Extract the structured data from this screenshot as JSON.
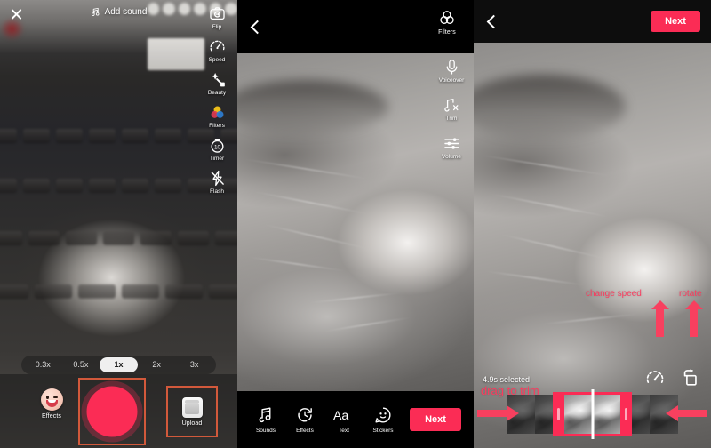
{
  "capture": {
    "close_icon": "close-x-icon",
    "add_sound_label": "Add sound",
    "music_icon": "music-note-icon",
    "tools": [
      {
        "label": "Flip",
        "icon": "camera-flip-icon"
      },
      {
        "label": "Speed",
        "icon": "speedometer-icon"
      },
      {
        "label": "Beauty",
        "icon": "beauty-wand-icon"
      },
      {
        "label": "Filters",
        "icon": "filters-circles-icon"
      },
      {
        "label": "Timer",
        "icon": "timer-10-icon"
      },
      {
        "label": "Flash",
        "icon": "flash-off-icon"
      }
    ],
    "speeds": [
      {
        "label": "0.3x",
        "selected": false
      },
      {
        "label": "0.5x",
        "selected": false
      },
      {
        "label": "1x",
        "selected": true
      },
      {
        "label": "2x",
        "selected": false
      },
      {
        "label": "3x",
        "selected": false
      }
    ],
    "effects_label": "Effects",
    "effects_icon": "smiley-wink-icon",
    "record_button": "record-shutter-button",
    "upload_label": "Upload",
    "upload_icon": "gallery-thumbnail-icon",
    "highlight_color": "#d2593b",
    "shutter_color": "#fb2c55"
  },
  "edit": {
    "back_icon": "chevron-left-icon",
    "filters_label": "Filters",
    "filters_icon": "filters-circles-icon",
    "side_tools": [
      {
        "label": "Voiceover",
        "icon": "microphone-icon"
      },
      {
        "label": "Trim",
        "icon": "music-trim-icon"
      },
      {
        "label": "Volume",
        "icon": "volume-sliders-icon"
      }
    ],
    "bottom_tools": [
      {
        "label": "Sounds",
        "icon": "music-note-icon"
      },
      {
        "label": "Effects",
        "icon": "effects-clock-icon"
      },
      {
        "label": "Text",
        "icon": "text-aa-icon"
      },
      {
        "label": "Stickers",
        "icon": "sticker-face-icon"
      }
    ],
    "next_label": "Next",
    "accent_color": "#fb2c55"
  },
  "trim": {
    "back_icon": "chevron-left-icon",
    "next_label": "Next",
    "annotations": {
      "change_speed": "change speed",
      "rotate": "rotate",
      "drag_to_trim": "drag to trim"
    },
    "selection_label": "4.9s selected",
    "tools": [
      {
        "label": "change speed",
        "icon": "speedometer-icon"
      },
      {
        "label": "rotate",
        "icon": "rotate-icon"
      }
    ],
    "annotation_color": "#fb3b5e",
    "accent_color": "#fb2c55"
  }
}
